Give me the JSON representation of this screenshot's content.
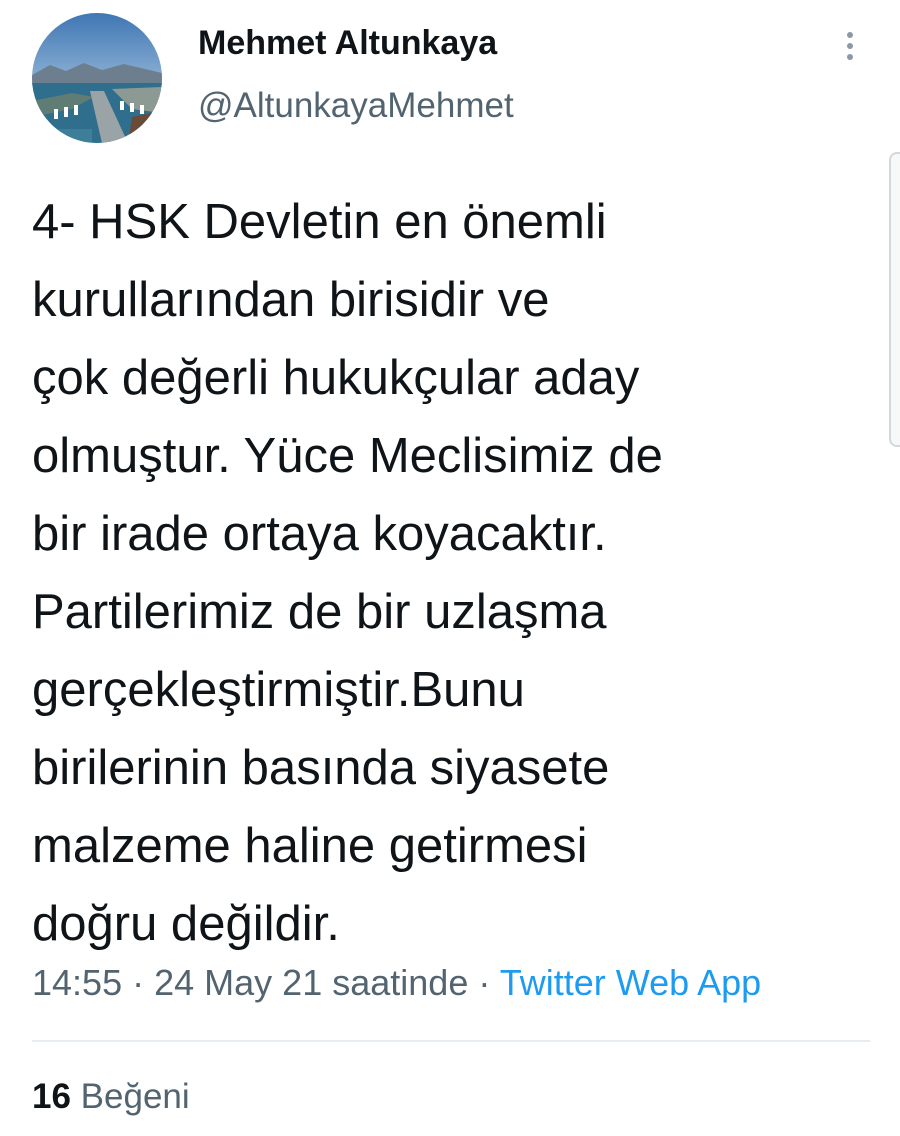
{
  "author": {
    "display_name": "Mehmet Altunkaya",
    "handle": "@AltunkayaMehmet",
    "avatar_icon": "avatar-harbor-photo"
  },
  "menu": {
    "icon": "more-vertical-icon"
  },
  "tweet": {
    "lines": [
      "4- HSK Devletin en önemli",
      "kurullarından birisidir ve",
      "çok değerli hukukçular aday",
      "olmuştur. Yüce Meclisimiz de",
      "bir irade ortaya koyacaktır.",
      "Partilerimiz de bir uzlaşma",
      "gerçekleştirmiştir.Bunu",
      "birilerinin basında siyasete",
      "malzeme haline getirmesi",
      "doğru değildir."
    ]
  },
  "meta": {
    "time": "14:55",
    "separator": "·",
    "date": "24 May 21 saatinde",
    "source": "Twitter Web App"
  },
  "stats": {
    "likes_count": "16",
    "likes_label": "Beğeni"
  },
  "colors": {
    "text": "#0f1419",
    "secondary": "#536471",
    "link": "#1d9bf0",
    "divider": "#e6ecf0"
  }
}
